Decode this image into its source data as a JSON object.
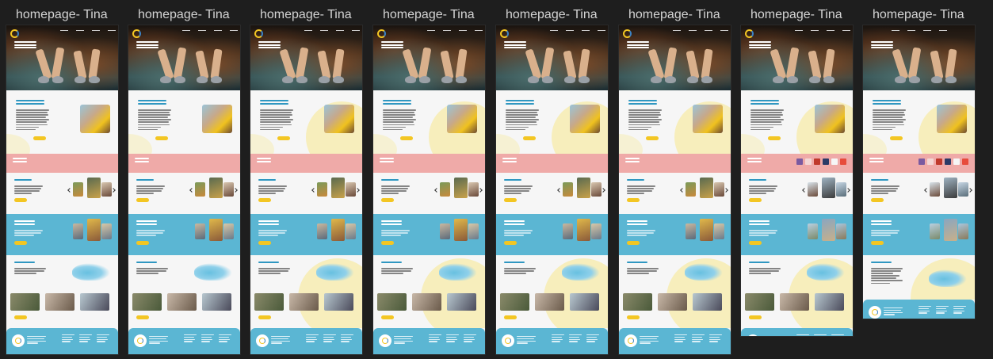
{
  "canvas": {
    "background": "#1e1e1e",
    "frames": [
      {
        "label": "homepage- Tina",
        "variant": "full"
      },
      {
        "label": "homepage- Tina",
        "variant": "full"
      },
      {
        "label": "homepage- Tina",
        "variant": "full-blob"
      },
      {
        "label": "homepage- Tina",
        "variant": "full-blob"
      },
      {
        "label": "homepage- Tina",
        "variant": "full-blob"
      },
      {
        "label": "homepage- Tina",
        "variant": "full-blob"
      },
      {
        "label": "homepage- Tina",
        "variant": "logos-short"
      },
      {
        "label": "homepage- Tina",
        "variant": "logos-short-nologo"
      }
    ]
  },
  "colors": {
    "accent_blue": "#2f97c1",
    "band_blue": "#5bb6d3",
    "band_pink": "#efaaa8",
    "yellow": "#f3c623",
    "blob_yellow": "#f7eebc"
  },
  "icons": [
    "logo-mark-icon"
  ]
}
